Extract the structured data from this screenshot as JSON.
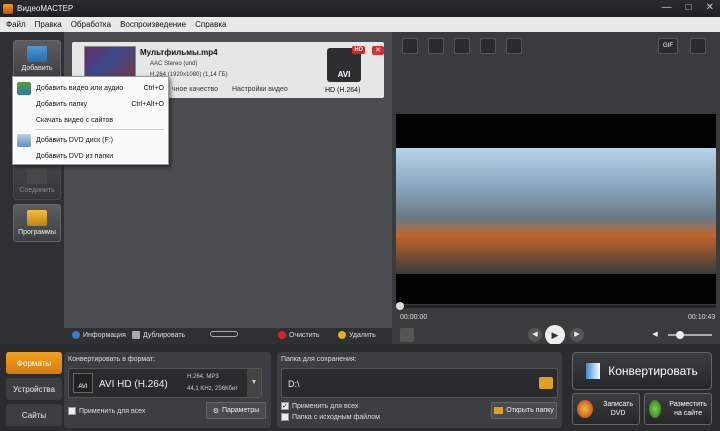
{
  "titlebar": {
    "title": "ВидеоМАСТЕР",
    "minimize": "—",
    "maximize": "□",
    "close": "✕"
  },
  "menu": [
    "Файл",
    "Правка",
    "Обработка",
    "Воспроизведение",
    "Справка"
  ],
  "leftbar": {
    "add": "Добавить",
    "join": "Соединить",
    "programs": "Программы"
  },
  "file": {
    "name": "Мультфильмы.mp4",
    "audio": "AAC Stereo (und)",
    "video": "H.264 (1920x1080) (1,14 ГБ)",
    "quality": "чное качество",
    "settings": "Настройки видео",
    "badge": "AVI",
    "badge_hd": "HD",
    "codec": "HD (H.264)"
  },
  "context_menu": {
    "items": [
      {
        "label": "Добавить видео или аудио",
        "shortcut": "Ctrl+O"
      },
      {
        "label": "Добавить папку",
        "shortcut": "Ctrl+Alt+O"
      },
      {
        "label": "Скачать видео с сайтов",
        "shortcut": ""
      },
      {
        "label": "Добавить DVD диск (F:)",
        "shortcut": ""
      },
      {
        "label": "Добавить DVD из папки",
        "shortcut": ""
      }
    ]
  },
  "tools": {
    "info": "Информация",
    "duplicate": "Дублировать",
    "clear": "Очистить",
    "delete": "Удалить"
  },
  "player": {
    "time_current": "00:00:00",
    "time_total": "00:10:43",
    "progress": 0.0,
    "gif": "GIF"
  },
  "tabs": {
    "formats": "Форматы",
    "devices": "Устройства",
    "sites": "Сайты"
  },
  "convert": {
    "label": "Конвертировать в формат:",
    "format": "AVI HD (H.264)",
    "spec1": "H.264, MP3",
    "spec2": "44,1 KHz, 256Кбит",
    "icon_label": "AVI",
    "apply_all": "Применить для всех",
    "params": "Параметры"
  },
  "save": {
    "label": "Папка для сохранения:",
    "path": "D:\\",
    "apply_all": "Применить для всех",
    "source_folder": "Папка с исходным файлом",
    "open": "Открыть папку"
  },
  "actions": {
    "convert": "Конвертировать",
    "burn": "Записать DVD",
    "publish": "Разместить на сайте"
  },
  "colors": {
    "accent": "#f2a21e",
    "delete": "#d22",
    "panel": "#3d3e41"
  }
}
